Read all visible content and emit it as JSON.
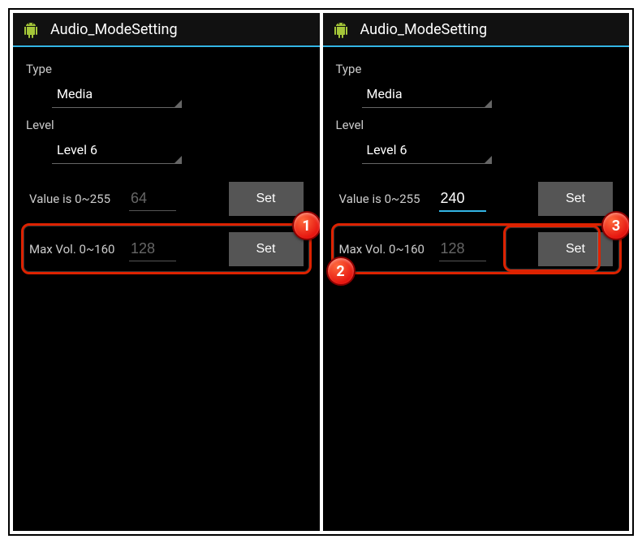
{
  "left": {
    "title": "Audio_ModeSetting",
    "type_label": "Type",
    "type_value": "Media",
    "level_label": "Level",
    "level_value": "Level 6",
    "value_row": {
      "label": "Value is 0~255",
      "placeholder": "64",
      "value": "",
      "button": "Set"
    },
    "max_row": {
      "label": "Max Vol. 0~160",
      "placeholder": "128",
      "value": "",
      "button": "Set"
    },
    "badges": {
      "b1": "1"
    }
  },
  "right": {
    "title": "Audio_ModeSetting",
    "type_label": "Type",
    "type_value": "Media",
    "level_label": "Level",
    "level_value": "Level 6",
    "value_row": {
      "label": "Value is 0~255",
      "placeholder": "",
      "value": "240",
      "button": "Set"
    },
    "max_row": {
      "label": "Max Vol. 0~160",
      "placeholder": "128",
      "value": "",
      "button": "Set"
    },
    "badges": {
      "b2": "2",
      "b3": "3"
    }
  }
}
